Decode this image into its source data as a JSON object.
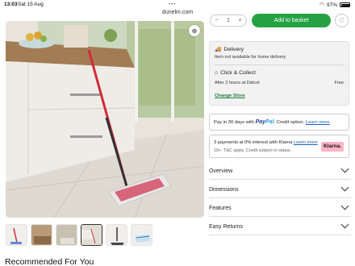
{
  "status_bar": {
    "time": "13:03",
    "date": "Sat 15 Aug",
    "url": "dunelm.com",
    "battery": "97%"
  },
  "product": {
    "zoom_icon": "zoom-icon",
    "thumbnail_count": 6
  },
  "purchase": {
    "qty_minus": "−",
    "qty_value": "1",
    "qty_plus": "+",
    "add_label": "Add to basket",
    "favourite_icon": "heart-icon"
  },
  "delivery": {
    "title": "Delivery",
    "status": "Item not available for home delivery",
    "collect_title": "Click & Collect",
    "collect_time": "After 2 hours at Didcot",
    "collect_price": "Free",
    "change_store": "Change Store"
  },
  "paypal": {
    "text": "Pay in 30 days with",
    "logo_a": "Pay",
    "logo_b": "Pal",
    "suffix": ". Credit option.",
    "learn": "Learn more"
  },
  "klarna": {
    "text": "3 payments at 0% interest with Klarna",
    "learn": "Learn more",
    "sub": "18+. T&C apply. Credit subject to status.",
    "badge": "Klarna."
  },
  "accordions": [
    "Overview",
    "Dimensions",
    "Features",
    "Easy Returns"
  ],
  "recommended_title": "Recommended For You",
  "colors": {
    "brand_green": "#25a244",
    "klarna_pink": "#ffb3c7",
    "link_blue": "#1a5fb4"
  }
}
